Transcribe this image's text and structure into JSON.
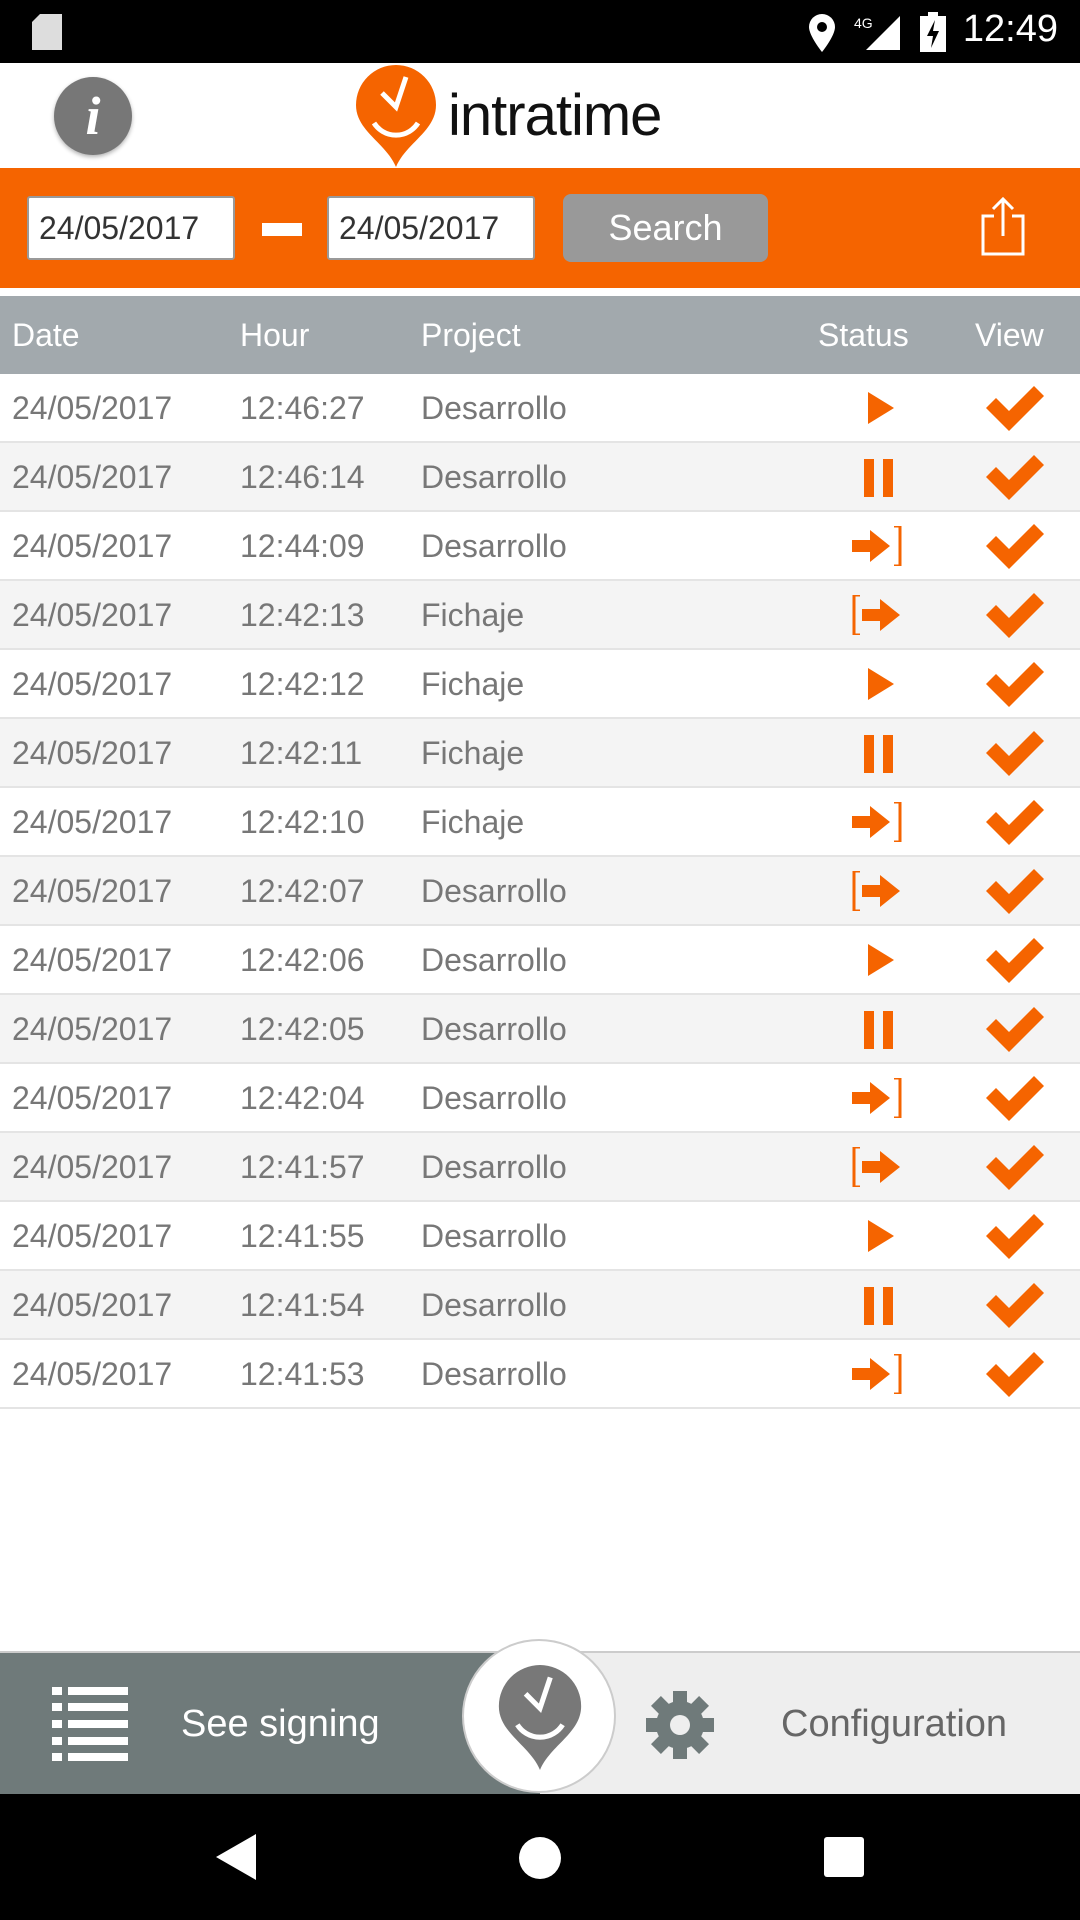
{
  "status_bar": {
    "time": "12:49",
    "icons": [
      "sd-card-icon",
      "location-icon",
      "signal-4g-icon",
      "battery-charging-icon"
    ]
  },
  "header": {
    "logo_text": "intratime",
    "info_icon": "info-icon"
  },
  "filter": {
    "date_from": "24/05/2017",
    "date_to": "24/05/2017",
    "search_label": "Search",
    "share_icon": "share-icon"
  },
  "table": {
    "columns": [
      "Date",
      "Hour",
      "Project",
      "Status",
      "View"
    ],
    "rows": [
      {
        "date": "24/05/2017",
        "hour": "12:46:27",
        "project": "Desarrollo",
        "status": "play"
      },
      {
        "date": "24/05/2017",
        "hour": "12:46:14",
        "project": "Desarrollo",
        "status": "pause"
      },
      {
        "date": "24/05/2017",
        "hour": "12:44:09",
        "project": "Desarrollo",
        "status": "exit"
      },
      {
        "date": "24/05/2017",
        "hour": "12:42:13",
        "project": "Fichaje",
        "status": "enter"
      },
      {
        "date": "24/05/2017",
        "hour": "12:42:12",
        "project": "Fichaje",
        "status": "play"
      },
      {
        "date": "24/05/2017",
        "hour": "12:42:11",
        "project": "Fichaje",
        "status": "pause"
      },
      {
        "date": "24/05/2017",
        "hour": "12:42:10",
        "project": "Fichaje",
        "status": "exit"
      },
      {
        "date": "24/05/2017",
        "hour": "12:42:07",
        "project": "Desarrollo",
        "status": "enter"
      },
      {
        "date": "24/05/2017",
        "hour": "12:42:06",
        "project": "Desarrollo",
        "status": "play"
      },
      {
        "date": "24/05/2017",
        "hour": "12:42:05",
        "project": "Desarrollo",
        "status": "pause"
      },
      {
        "date": "24/05/2017",
        "hour": "12:42:04",
        "project": "Desarrollo",
        "status": "exit"
      },
      {
        "date": "24/05/2017",
        "hour": "12:41:57",
        "project": "Desarrollo",
        "status": "enter"
      },
      {
        "date": "24/05/2017",
        "hour": "12:41:55",
        "project": "Desarrollo",
        "status": "play"
      },
      {
        "date": "24/05/2017",
        "hour": "12:41:54",
        "project": "Desarrollo",
        "status": "pause"
      },
      {
        "date": "24/05/2017",
        "hour": "12:41:53",
        "project": "Desarrollo",
        "status": "exit"
      }
    ]
  },
  "bottom_bar": {
    "see_signing": "See signing",
    "configuration": "Configuration"
  },
  "colors": {
    "accent": "#f56400",
    "header_gray": "#a2a9ad",
    "bottom_dark": "#6f7a7a"
  }
}
